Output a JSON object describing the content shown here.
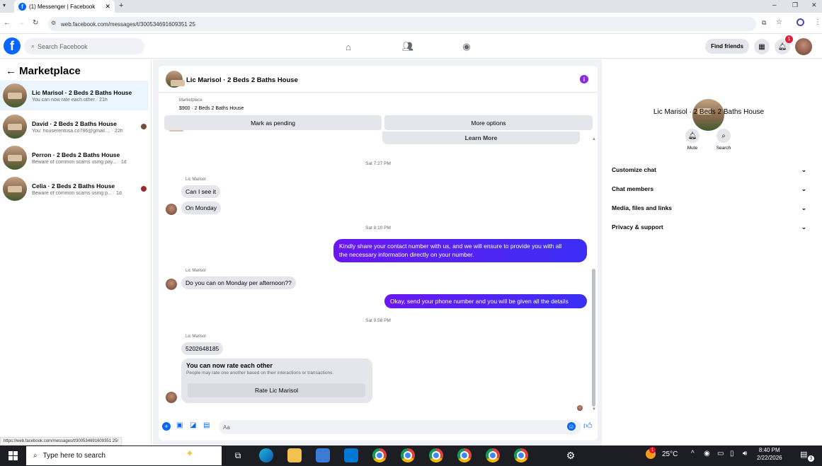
{
  "browser": {
    "tab_title": "(1) Messenger | Facebook",
    "url": "web.facebook.com/messages/t/300534691609351 25",
    "status_url": "https://web.facebook.com/messages/t/300534691609351 25/"
  },
  "header": {
    "search_placeholder": "Search Facebook",
    "find_friends": "Find friends",
    "notification_count": "1"
  },
  "sidebar": {
    "title": "Marketplace",
    "conversations": [
      {
        "name": "Lic Marisol · 2 Beds 2 Baths House",
        "preview": "You can now rate each other · 21h"
      },
      {
        "name": "David · 2 Beds 2 Baths House",
        "preview": "You: houserentusa.co786@gmail.... · 22h"
      },
      {
        "name": "Perron · 2 Beds 2 Baths House",
        "preview": "Beware of common scams using pay... · 1d"
      },
      {
        "name": "Celia · 2 Beds 2 Baths House",
        "preview": "Beware of common scams using p... · 1d"
      }
    ]
  },
  "chat": {
    "title": "Lic Marisol · 2 Beds 2 Baths House",
    "listing_label": "Marketplace",
    "listing_price": "$900 · 2 Beds 2 Baths House",
    "mark_pending": "Mark as pending",
    "more_options": "More options",
    "learn_more": "Learn More",
    "ts1": "Sat 7:27 PM",
    "ts2": "Sat 8:10 PM",
    "ts3": "Sat 9:58 PM",
    "sender": "Lic Marisol",
    "msg1": "Can I see it",
    "msg2": "On Monday",
    "msg3_line1": "Kindly share your contact number with us, and we will ensure to provide you with all",
    "msg3_line2": "the necessary information directly on your number.",
    "msg4": "Do you can on Monday per afternoon??",
    "msg5": "Okay, send your phone number and you will be given all the details",
    "msg6": "5202648185",
    "rate_title": "You can now rate each other",
    "rate_sub": "People may rate one another based on their interactions or transactions.",
    "rate_button": "Rate Lic Marisol",
    "composer_placeholder": "Aa"
  },
  "details": {
    "name": "Lic Marisol · 2 Beds 2 Baths House",
    "mute": "Mute",
    "search": "Search",
    "sections": [
      "Customize chat",
      "Chat members",
      "Media, files and links",
      "Privacy & support"
    ]
  },
  "taskbar": {
    "search_placeholder": "Type here to search",
    "temperature": "25°C",
    "time": "8:40 PM",
    "date": "2/22/2026",
    "weather_badge": "1",
    "notif_badge": "3"
  }
}
